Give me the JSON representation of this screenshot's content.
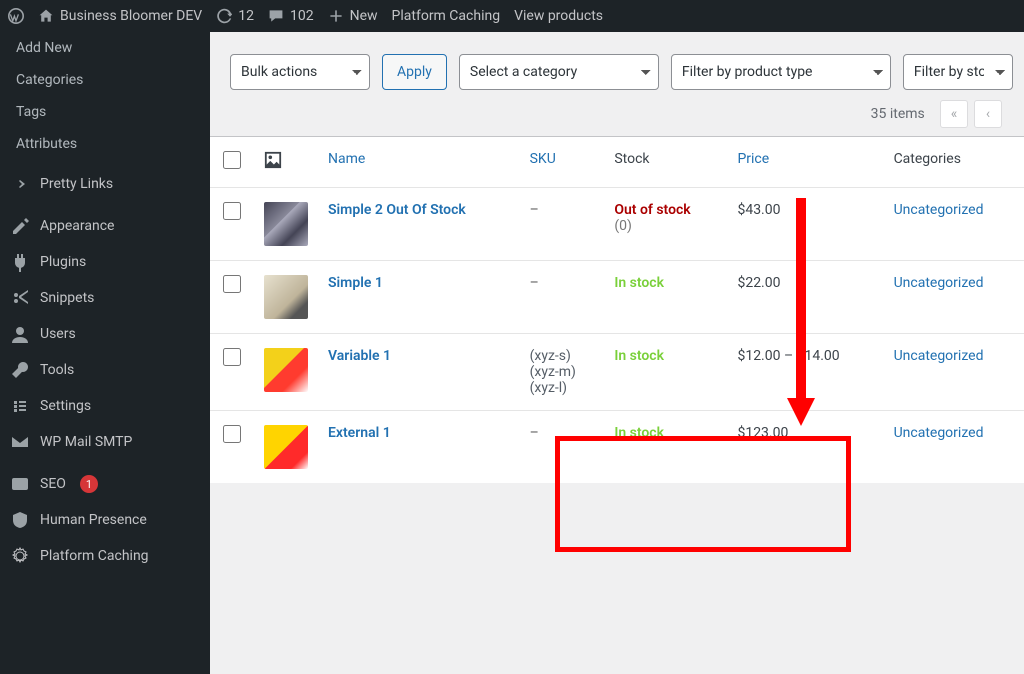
{
  "adminbar": {
    "site_name": "Business Bloomer DEV",
    "updates": "12",
    "comments": "102",
    "new": "New",
    "caching": "Platform Caching",
    "view": "View products"
  },
  "sidebar": {
    "sub": [
      {
        "label": "Add New"
      },
      {
        "label": "Categories"
      },
      {
        "label": "Tags"
      },
      {
        "label": "Attributes"
      }
    ],
    "items": [
      {
        "label": "Pretty Links"
      },
      {
        "label": "Appearance"
      },
      {
        "label": "Plugins"
      },
      {
        "label": "Snippets"
      },
      {
        "label": "Users"
      },
      {
        "label": "Tools"
      },
      {
        "label": "Settings"
      },
      {
        "label": "WP Mail SMTP"
      },
      {
        "label": "SEO",
        "badge": "1"
      },
      {
        "label": "Human Presence"
      },
      {
        "label": "Platform Caching"
      }
    ]
  },
  "filters": {
    "bulk": "Bulk actions",
    "apply": "Apply",
    "category": "Select a category",
    "type": "Filter by product type",
    "stock": "Filter by sto"
  },
  "pagination": {
    "items": "35 items",
    "prev_all": "«",
    "prev": "‹"
  },
  "columns": {
    "name": "Name",
    "sku": "SKU",
    "stock": "Stock",
    "price": "Price",
    "categories": "Categories"
  },
  "rows": [
    {
      "name": "Simple 2 Out Of Stock",
      "sku": "–",
      "stock_type": "out",
      "stock_label": "Out of stock",
      "stock_qty": "(0)",
      "price": "$43.00",
      "category": "Uncategorized",
      "thumb": "thumb1"
    },
    {
      "name": "Simple 1",
      "sku": "–",
      "stock_type": "in",
      "stock_label": "In stock",
      "price": "$22.00",
      "category": "Uncategorized",
      "thumb": "thumb2"
    },
    {
      "name": "Variable 1",
      "sku_list": [
        "(xyz-s)",
        "(xyz-m)",
        "(xyz-l)"
      ],
      "stock_type": "in",
      "stock_label": "In stock",
      "price": "$12.00 – $14.00",
      "category": "Uncategorized",
      "thumb": "thumb3"
    },
    {
      "name": "External 1",
      "sku": "–",
      "stock_type": "in",
      "stock_label": "In stock",
      "price": "$123.00",
      "category": "Uncategorized",
      "thumb": "thumb4"
    }
  ]
}
